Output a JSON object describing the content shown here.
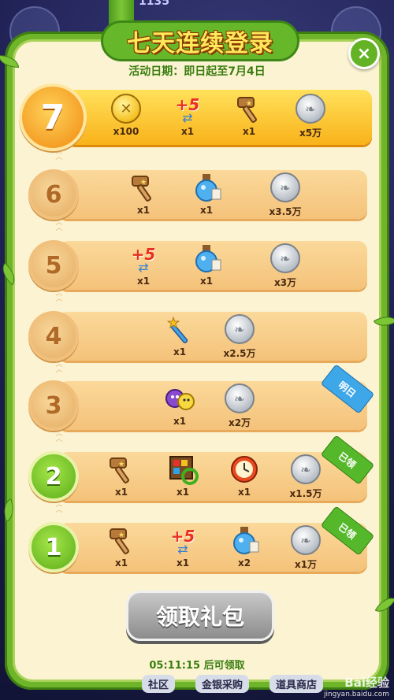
{
  "top_score": "1135",
  "title": "七天连续登录",
  "subtitle": "活动日期：即日起至7月4日",
  "close_label": "×",
  "days": [
    {
      "day": "7",
      "state": "today",
      "items": [
        {
          "icon": "gold-coin-icon",
          "qty": "x100"
        },
        {
          "icon": "plus-five-moves-icon",
          "qty": "x1",
          "label": "+5"
        },
        {
          "icon": "hammer-icon",
          "qty": "x1"
        },
        {
          "icon": "silver-coin-icon",
          "qty": "x5万"
        }
      ]
    },
    {
      "day": "6",
      "state": "locked",
      "items": [
        {
          "icon": "hammer-icon",
          "qty": "x1"
        },
        {
          "icon": "potion-icon",
          "qty": "x1"
        },
        {
          "icon": "silver-coin-icon",
          "qty": "x3.5万"
        }
      ]
    },
    {
      "day": "5",
      "state": "locked",
      "items": [
        {
          "icon": "plus-five-moves-icon",
          "qty": "x1",
          "label": "+5"
        },
        {
          "icon": "potion-icon",
          "qty": "x1"
        },
        {
          "icon": "silver-coin-icon",
          "qty": "x3万"
        }
      ]
    },
    {
      "day": "4",
      "state": "locked",
      "items": [
        {
          "icon": "magic-wand-icon",
          "qty": "x1"
        },
        {
          "icon": "silver-coin-icon",
          "qty": "x2.5万"
        }
      ]
    },
    {
      "day": "3",
      "state": "tomorrow",
      "ribbon": "明日",
      "items": [
        {
          "icon": "monster-pet-icon",
          "qty": "x1"
        },
        {
          "icon": "silver-coin-icon",
          "qty": "x2万"
        }
      ]
    },
    {
      "day": "2",
      "state": "claimed",
      "ribbon": "已领",
      "items": [
        {
          "icon": "hammer-icon",
          "qty": "x1"
        },
        {
          "icon": "shuffle-board-icon",
          "qty": "x1"
        },
        {
          "icon": "clock-icon",
          "qty": "x1"
        },
        {
          "icon": "silver-coin-icon",
          "qty": "x1.5万"
        }
      ]
    },
    {
      "day": "1",
      "state": "claimed",
      "ribbon": "已领",
      "items": [
        {
          "icon": "hammer-icon",
          "qty": "x1"
        },
        {
          "icon": "plus-five-moves-icon",
          "qty": "x1",
          "label": "+5"
        },
        {
          "icon": "potion-icon",
          "qty": "x2"
        },
        {
          "icon": "silver-coin-icon",
          "qty": "x1万"
        }
      ]
    }
  ],
  "claim_button": "领取礼包",
  "countdown": "05:11:15 后可领取",
  "bottom_tabs": [
    "社区",
    "金银采购",
    "道具商店"
  ],
  "watermark": {
    "brand": "Bai经验",
    "url": "jingyan.baidu.com"
  },
  "colors": {
    "vine_green": "#6fb52a",
    "panel_cream": "#fbf3d2",
    "bar_orange": "#f4c27a",
    "today_gold": "#f9b21a",
    "ribbon_blue": "#3ea7e8",
    "ribbon_green": "#55b82a"
  }
}
